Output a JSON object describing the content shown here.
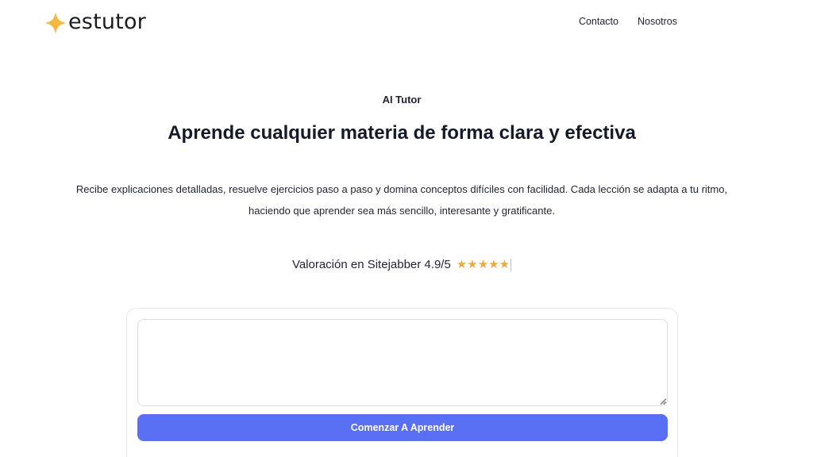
{
  "brand": {
    "name": "estutor",
    "logo_icon": "four-point-star-icon",
    "accent_color": "#f5b942"
  },
  "nav": {
    "items": [
      {
        "label": "Contacto"
      },
      {
        "label": "Nosotros"
      }
    ]
  },
  "hero": {
    "eyebrow": "AI Tutor",
    "headline": "Aprende cualquier materia de forma clara y efectiva",
    "description_line1": "Recibe explicaciones detalladas, resuelve ejercicios paso a paso y domina conceptos difíciles con facilidad. Cada lección se adapta a tu ritmo,",
    "description_line2": "haciendo que aprender sea más sencillo, interesante y gratificante."
  },
  "rating": {
    "label": "Valoración en Sitejabber 4.9/5",
    "stars_filled": 4.9,
    "stars_total": 5,
    "star_color": "#f0a93b"
  },
  "form": {
    "input_value": "",
    "input_placeholder": "",
    "submit_label": "Comenzar A Aprender",
    "button_color": "#5a70f4"
  }
}
